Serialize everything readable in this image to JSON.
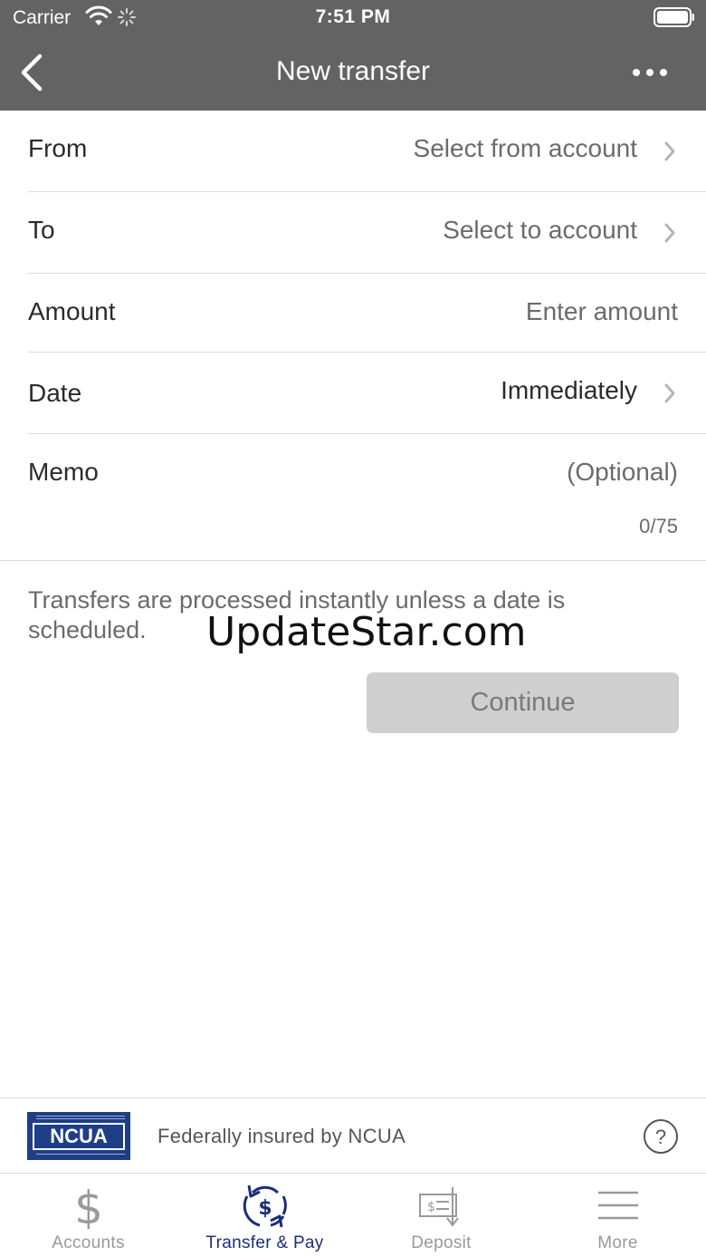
{
  "status_bar": {
    "carrier": "Carrier",
    "time": "7:51 PM"
  },
  "nav": {
    "title": "New transfer"
  },
  "form": {
    "from": {
      "label": "From",
      "value": "Select from account"
    },
    "to": {
      "label": "To",
      "value": "Select to account"
    },
    "amount": {
      "label": "Amount",
      "placeholder": "Enter amount"
    },
    "date": {
      "label": "Date",
      "value": "Immediately"
    },
    "memo": {
      "label": "Memo",
      "placeholder": "(Optional)",
      "counter": "0/75"
    }
  },
  "info_text": "Transfers are processed instantly unless a date is scheduled.",
  "watermark": "UpdateStar.com",
  "continue_label": "Continue",
  "ncua": {
    "logo_text": "NCUA",
    "text": "Federally insured by NCUA"
  },
  "tabs": [
    {
      "label": "Accounts",
      "icon": "dollar-icon"
    },
    {
      "label": "Transfer & Pay",
      "icon": "transfer-icon"
    },
    {
      "label": "Deposit",
      "icon": "check-deposit-icon"
    },
    {
      "label": "More",
      "icon": "menu-icon"
    }
  ],
  "colors": {
    "header": "#636363",
    "accent": "#1b2e7a",
    "button_disabled": "#cfcfcf",
    "ncua_blue": "#1e3f86"
  }
}
